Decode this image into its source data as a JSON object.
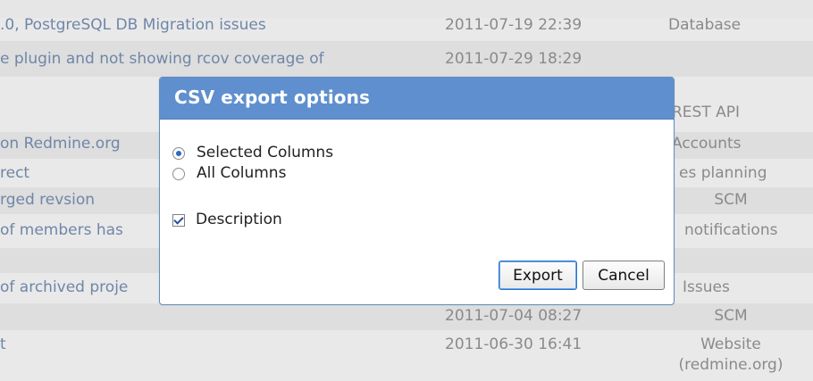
{
  "table": {
    "rows": [
      {
        "subject": ".0, PostgreSQL DB Migration issues",
        "date": "2011-07-19 22:39",
        "category": "Database",
        "category_align": "left",
        "shade": "light"
      },
      {
        "subject": "e plugin and not showing rcov coverage of",
        "date": "2011-07-29 18:29",
        "category": "",
        "category_align": "left",
        "shade": "shade"
      },
      {
        "subject": "",
        "date": "",
        "category": "REST API",
        "category_align": "left",
        "shade": "light"
      },
      {
        "subject": " on Redmine.org",
        "date": "",
        "category": "Accounts",
        "category_align": "left",
        "shade": "shade"
      },
      {
        "subject": "rect",
        "date": "",
        "category": "es planning",
        "category_align": "left",
        "shade": "light"
      },
      {
        "subject": "rged revsion",
        "date": "",
        "category": "SCM",
        "category_align": "center",
        "shade": "shade"
      },
      {
        "subject": "of members has",
        "date": "",
        "category": "notifications",
        "category_align": "left",
        "shade": "light"
      },
      {
        "subject": "",
        "date": "",
        "category": "",
        "category_align": "left",
        "shade": "shade"
      },
      {
        "subject": "of archived proje",
        "date": "",
        "category": "Issues",
        "category_align": "left",
        "shade": "light"
      },
      {
        "subject": "",
        "date": "2011-07-04 08:27",
        "category": "SCM",
        "category_align": "center",
        "shade": "shade"
      },
      {
        "subject": "t",
        "date": "2011-06-30 16:41",
        "category": "Website",
        "category_align": "center",
        "shade": "light"
      },
      {
        "subject": "",
        "date": "",
        "category": "(redmine.org)",
        "category_align": "center",
        "shade": "light"
      }
    ]
  },
  "dialog": {
    "title": "CSV export options",
    "options": {
      "selected_columns": "Selected Columns",
      "all_columns": "All Columns",
      "description": "Description"
    },
    "buttons": {
      "export": "Export",
      "cancel": "Cancel"
    }
  },
  "colors": {
    "dialog_title_bg": "#5f8fce",
    "dialog_border": "#5f8dc4",
    "link_text": "#6f86a8",
    "background": "#e6e6e6"
  }
}
